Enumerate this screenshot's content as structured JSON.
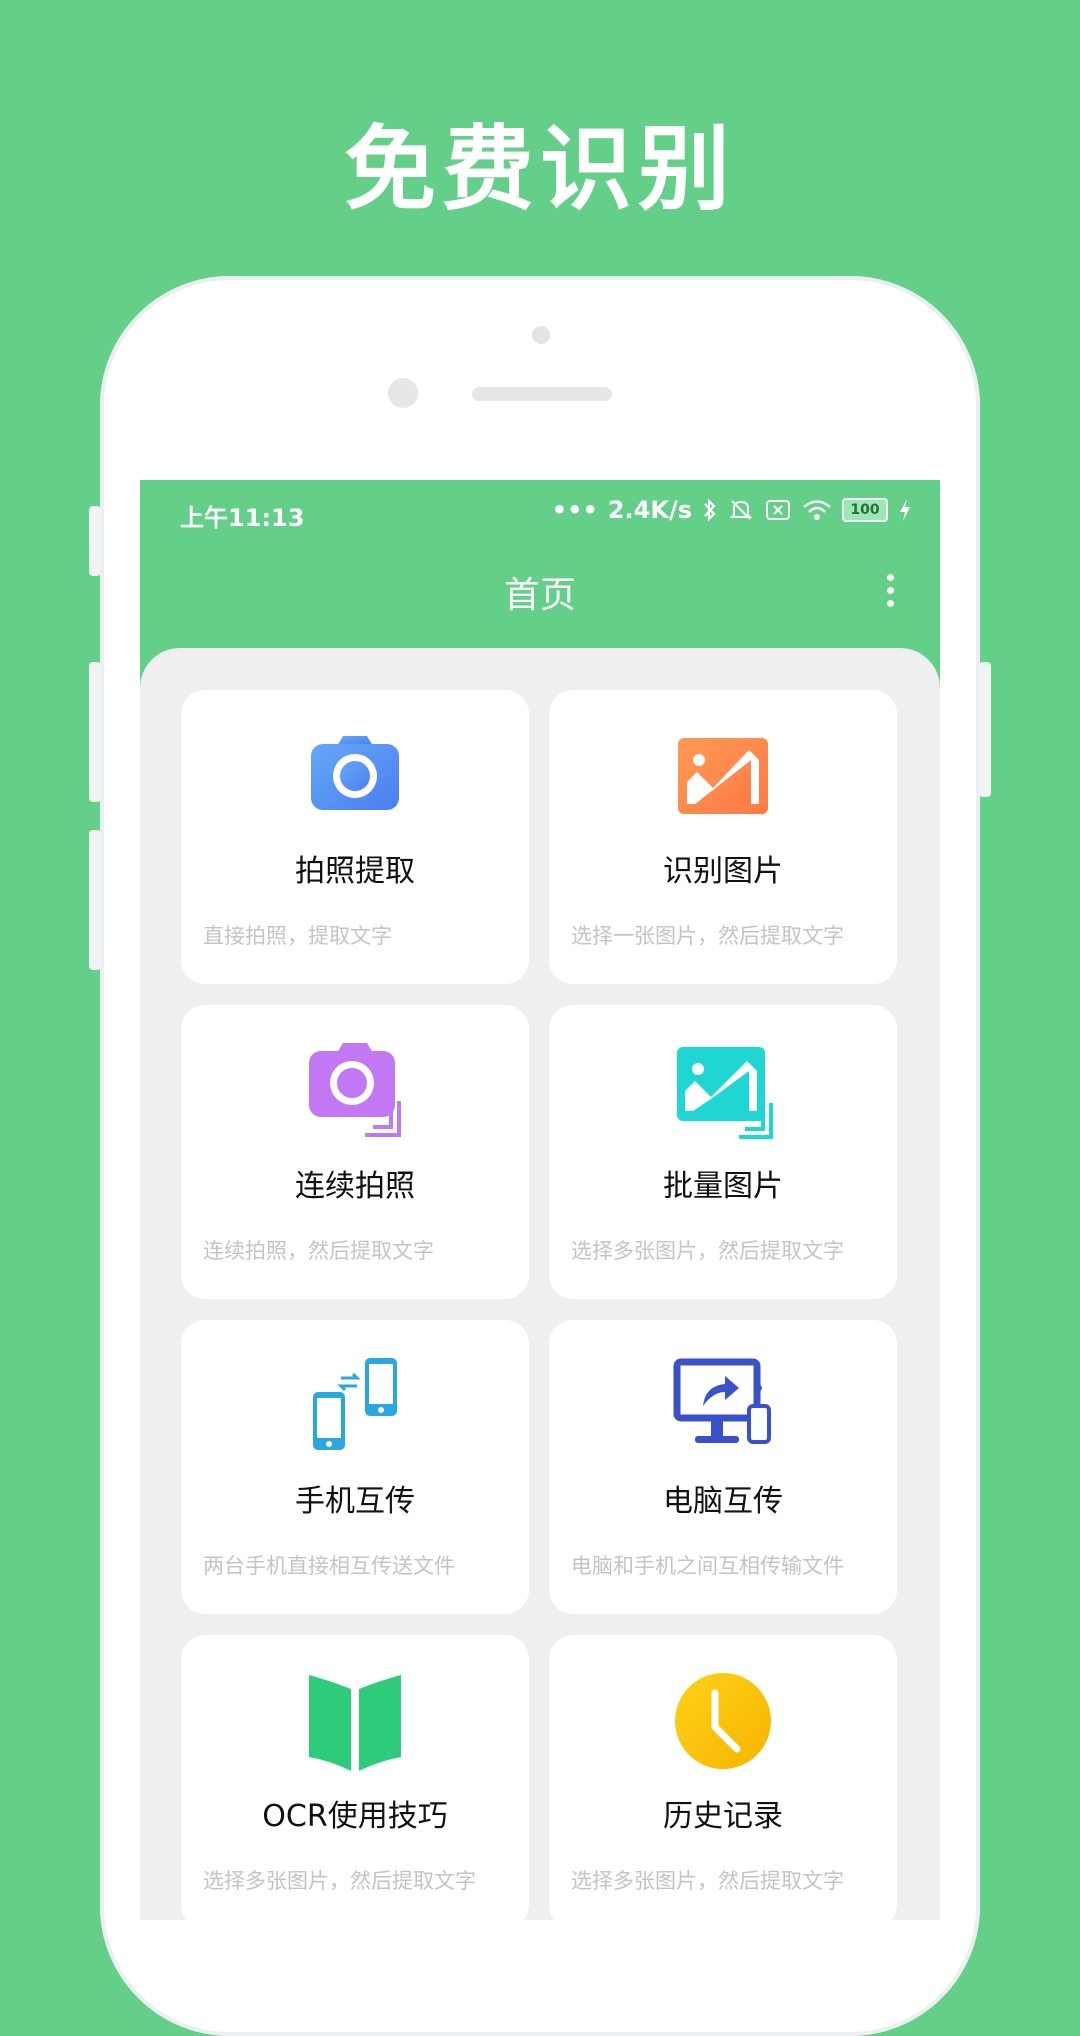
{
  "promo": {
    "title": "免费识别"
  },
  "status_bar": {
    "time": "上午11:13",
    "net_speed": "2.4K/s",
    "battery": "100"
  },
  "app_bar": {
    "title": "首页",
    "more_icon": "more-vertical-icon"
  },
  "features": [
    {
      "title": "拍照提取",
      "desc": "直接拍照，提取文字",
      "icon": "camera-icon",
      "color": "#5b8ef5"
    },
    {
      "title": "识别图片",
      "desc": "选择一张图片，然后提取文字",
      "icon": "image-icon",
      "color": "#ff8447"
    },
    {
      "title": "连续拍照",
      "desc": "连续拍照，然后提取文字",
      "icon": "camera-multi-icon",
      "color": "#c178f2"
    },
    {
      "title": "批量图片",
      "desc": "选择多张图片，然后提取文字",
      "icon": "image-multi-icon",
      "color": "#1fd6d3"
    },
    {
      "title": "手机互传",
      "desc": "两台手机直接相互传送文件",
      "icon": "phone-transfer-icon",
      "color": "#2aa6e0"
    },
    {
      "title": "电脑互传",
      "desc": "电脑和手机之间互相传输文件",
      "icon": "pc-transfer-icon",
      "color": "#3a52c9"
    },
    {
      "title": "OCR使用技巧",
      "desc": "选择多张图片，然后提取文字",
      "icon": "book-icon",
      "color": "#2ecc7a"
    },
    {
      "title": "历史记录",
      "desc": "选择多张图片，然后提取文字",
      "icon": "clock-icon",
      "color": "#f7c200"
    }
  ]
}
